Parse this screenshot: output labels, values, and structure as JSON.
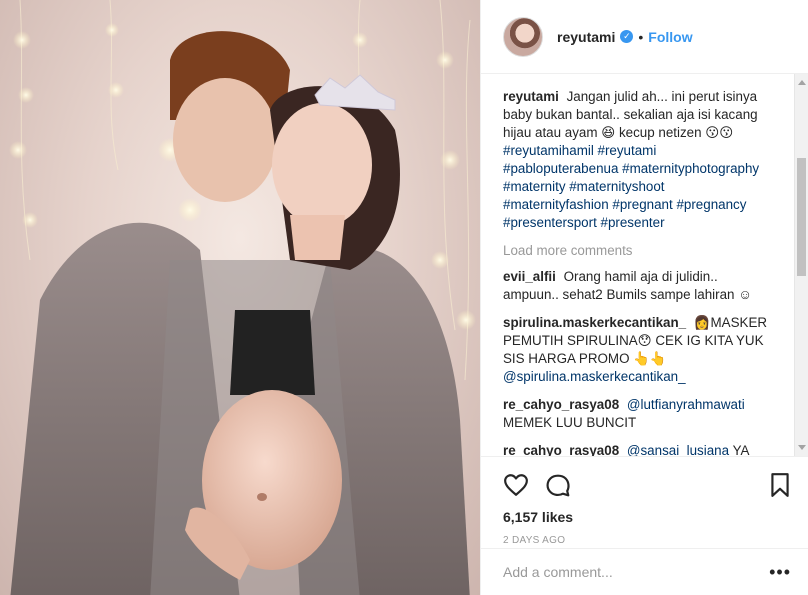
{
  "post": {
    "author": "reyutami",
    "follow_label": "Follow",
    "separator": "•",
    "verified_icon": "verified-badge-icon"
  },
  "comments": [
    {
      "user": "reyutami",
      "text": "Jangan julid ah... ini perut isinya baby bukan bantal.. sekalian aja isi kacang hijau atau ayam 😆 kecup netizen 😗😗",
      "tags": "#reyutamihamil #reyutami #pabloputerabenua #maternityphotography #maternity #maternityshoot #maternityfashion #pregnant #pregnancy #presentersport #presenter"
    },
    {
      "user": "evii_alfii",
      "text": "Orang hamil aja di julidin.. ampuun.. sehat2 Bumils sampe lahiran ☺"
    },
    {
      "user": "spirulina.maskerkecantikan_",
      "text": "👩MASKER PEMUTIH SPIRULINA😯 CEK IG KITA YUK SIS HARGA PROMO 👆👆",
      "mention": "@spirulina.maskerkecantikan_"
    },
    {
      "user": "re_cahyo_rasya08",
      "mention": "@lutfianyrahmawati",
      "text": "MEMEK LUU BUNCIT"
    },
    {
      "user": "re_cahyo_rasya08",
      "mention": "@sansai_lusiana",
      "text": "YA"
    }
  ],
  "load_more": "Load more comments",
  "likes": "6,157 likes",
  "timestamp": "2 DAYS AGO",
  "add_comment_placeholder": "Add a comment...",
  "more_options": "•••",
  "colors": {
    "link": "#3897f0",
    "hashtag": "#003569",
    "muted": "#999999",
    "text": "#262626"
  }
}
